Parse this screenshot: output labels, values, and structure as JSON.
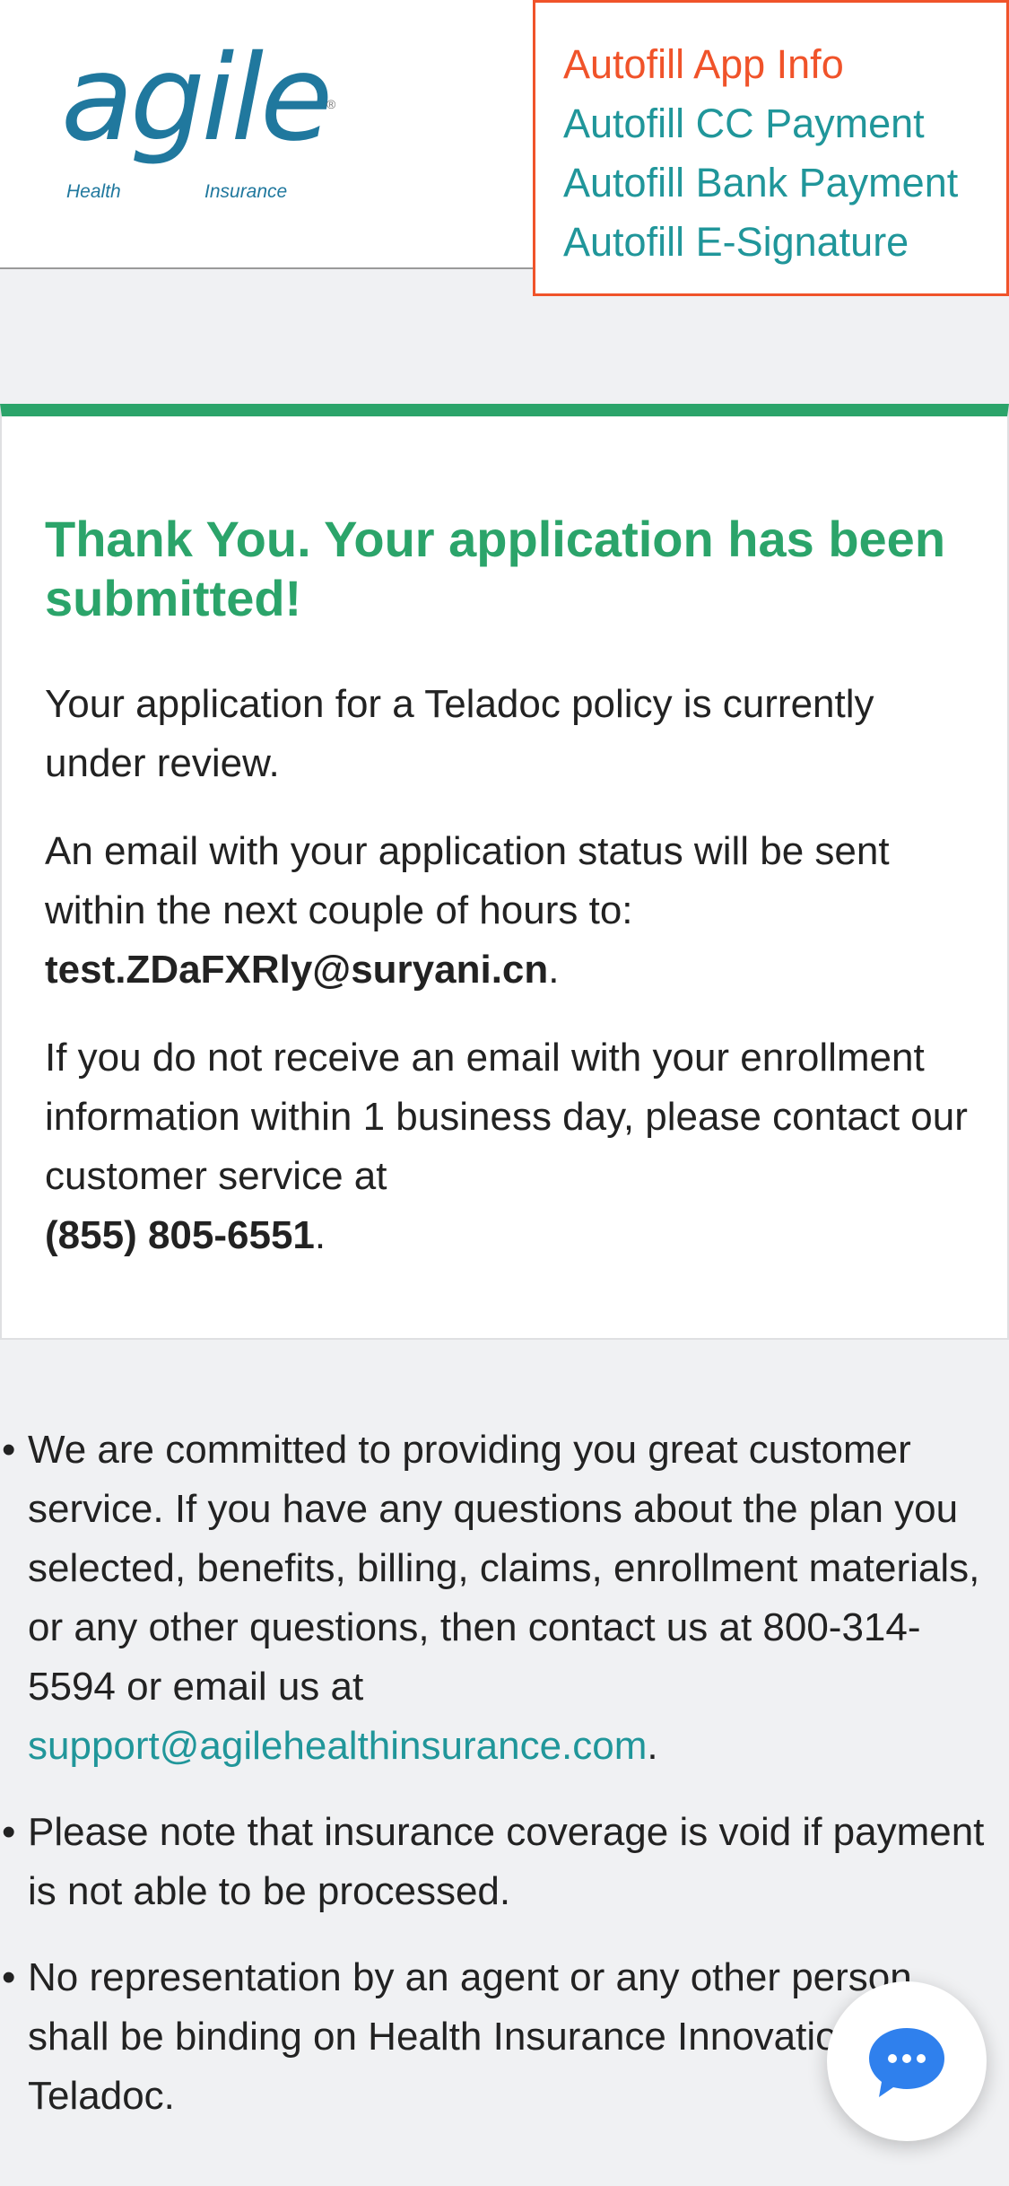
{
  "brand": {
    "logo_word": "agile",
    "logo_registered": "®",
    "logo_sub_left": "Health",
    "logo_sub_right": "Insurance",
    "accent": "#20789e"
  },
  "autofill_menu": {
    "items": [
      {
        "label": "Autofill App Info",
        "active": true
      },
      {
        "label": "Autofill CC Payment",
        "active": false
      },
      {
        "label": "Autofill Bank Payment",
        "active": false
      },
      {
        "label": "Autofill E-Signature",
        "active": false
      }
    ],
    "active_color": "#f0532a",
    "link_color": "#20969a"
  },
  "confirmation": {
    "title_bold": "Thank You.",
    "title_rest": "Your application has been submitted!",
    "review_text": "Your application for a Teladoc  policy is currently under review.",
    "email_text": "An email with your application status will be sent within the next couple of hours to:",
    "email_address": "test.ZDaFXRly@suryani.cn",
    "email_period": ".",
    "contact_text": "If you do not receive an email with your enrollment information within 1 business day, please contact our customer service at",
    "phone": "(855) 805-6551",
    "phone_period": ".",
    "accent": "#2ba46a"
  },
  "notes": {
    "bullet": "•",
    "item1_text": "We are committed to providing you great customer service. If you have any questions about the plan you selected, benefits, billing, claims, enrollment materials, or any other questions, then contact us at 800-314-5594 or email us at",
    "item1_link": "support@agilehealthinsurance.com",
    "item1_period": ".",
    "item2_text": "Please note that insurance coverage is void if payment is not able to be processed.",
    "item3_text": "No representation by an agent or any other person shall be binding on Health Insurance Innovations or Teladoc."
  },
  "chat": {
    "icon": "chat-bubble-icon",
    "color": "#2f80ed"
  }
}
